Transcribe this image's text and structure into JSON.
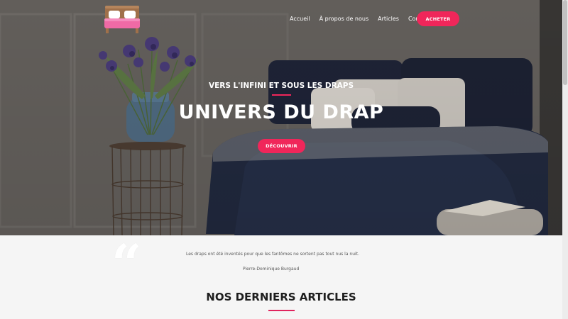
{
  "nav": {
    "items": [
      "Accueil",
      "À propos de nous",
      "Articles",
      "Contact"
    ],
    "cta_label": "ACHETER"
  },
  "hero": {
    "kicker": "VERS L'INFINI ET SOUS LES DRAPS",
    "title": "UNIVERS DU DRAP",
    "button_label": "DÉCOUVRIR"
  },
  "quote": {
    "mark": "“",
    "text": "Les draps ont été inventés pour que les fantômes ne sortent pas tout nus la nuit.",
    "author": "Pierre-Dominique Burgaud"
  },
  "articles": {
    "title": "NOS DERNIERS ARTICLES"
  },
  "colors": {
    "accent": "#f0265a",
    "hero_bg": "#625f5c",
    "section_bg": "#f5f5f5"
  },
  "icons": {
    "logo": "bed-icon"
  }
}
